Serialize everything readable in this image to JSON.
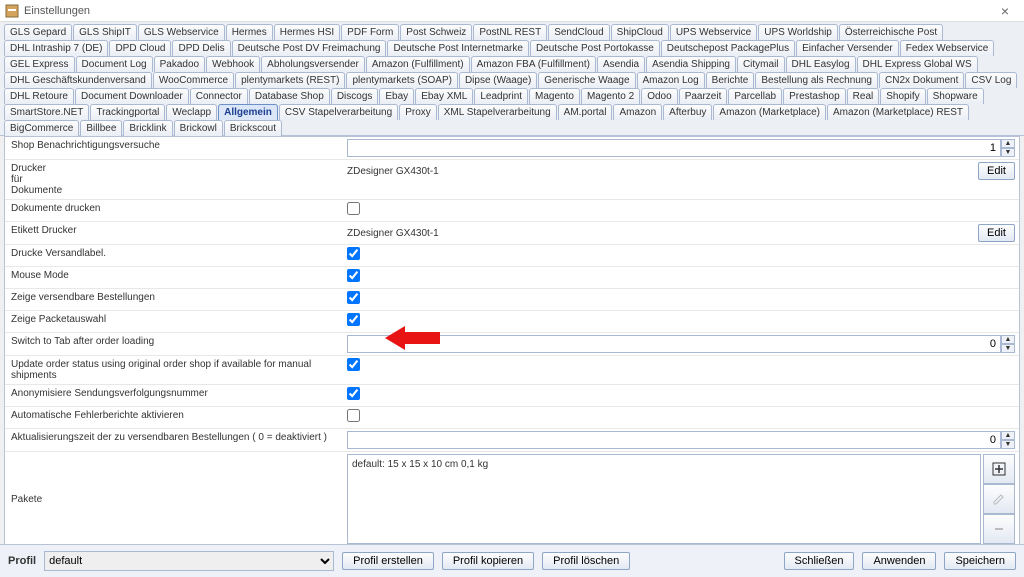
{
  "window": {
    "title": "Einstellungen"
  },
  "tabs_primary": [
    "GLS Gepard",
    "GLS ShipIT",
    "GLS Webservice",
    "Hermes",
    "Hermes HSI",
    "PDF Form",
    "Post Schweiz",
    "PostNL REST",
    "SendCloud",
    "ShipCloud",
    "UPS Webservice",
    "UPS Worldship",
    "Österreichische Post",
    "DHL Intraship 7 (DE)",
    "DPD Cloud",
    "DPD Delis",
    "Deutsche Post DV Freimachung",
    "Deutsche Post Internetmarke",
    "Deutsche Post Portokasse",
    "Deutschepost PackagePlus",
    "Einfacher Versender",
    "Fedex Webservice",
    "GEL Express",
    "Document Log",
    "Pakadoo",
    "Webhook",
    "Abholungsversender",
    "Amazon (Fulfillment)",
    "Amazon FBA (Fulfillment)",
    "Asendia",
    "Asendia Shipping",
    "Citymail",
    "DHL Easylog",
    "DHL Express Global WS",
    "DHL Geschäftskundenversand",
    "WooCommerce",
    "plentymarkets (REST)",
    "plentymarkets (SOAP)",
    "Dipse (Waage)",
    "Generische Waage",
    "Amazon Log",
    "Berichte",
    "Bestellung als Rechnung",
    "CN2x Dokument",
    "CSV Log",
    "DHL Retoure",
    "Document Downloader",
    "Connector",
    "Database Shop",
    "Discogs",
    "Ebay",
    "Ebay XML",
    "Leadprint",
    "Magento",
    "Magento 2",
    "Odoo",
    "Paarzeit",
    "Parcellab",
    "Prestashop",
    "Real",
    "Shopify",
    "Shopware",
    "SmartStore.NET",
    "Trackingportal",
    "Weclapp",
    "Allgemein",
    "CSV Stapelverarbeitung",
    "Proxy",
    "XML Stapelverarbeitung",
    "AM.portal",
    "Amazon",
    "Afterbuy",
    "Amazon (Marketplace)",
    "Amazon (Marketplace) REST",
    "BigCommerce",
    "Billbee",
    "Bricklink",
    "Brickowl",
    "Brickscout"
  ],
  "tabs_active": "Allgemein",
  "form": {
    "shop_notif_label": "Shop Benachrichtigungsversuche",
    "shop_notif_value": "1",
    "printer_label": "Drucker\nfür\nDokumente",
    "printer_value": "ZDesigner GX430t-1",
    "edit_label": "Edit",
    "print_docs_label": "Dokumente drucken",
    "label_printer_label": "Etikett Drucker",
    "label_printer_value": "ZDesigner GX430t-1",
    "print_shipping_label": "Drucke Versandlabel.",
    "mouse_mode_label": "Mouse Mode",
    "show_shippable_label": "Zeige versendbare Bestellungen",
    "show_packet_label": "Zeige Packetauswahl",
    "switch_tab_label": "Switch to Tab after order loading",
    "switch_tab_value": "0",
    "update_order_label": "Update order status using original order shop if available for manual shipments",
    "anonymize_label": "Anonymisiere Sendungsverfolgungsnummer",
    "auto_error_label": "Automatische Fehlerberichte aktivieren",
    "refresh_time_label": "Aktualisierungszeit der zu versendbaren Bestellungen ( 0 = deaktiviert )",
    "refresh_time_value": "0",
    "packages_label": "Pakete",
    "packages_default": "default: 15 x 15 x 10 cm 0,1 kg"
  },
  "footer": {
    "profile_label": "Profil",
    "profile_value": "default",
    "create_btn": "Profil erstellen",
    "copy_btn": "Profil kopieren",
    "delete_btn": "Profil löschen",
    "close_btn": "Schließen",
    "apply_btn": "Anwenden",
    "save_btn": "Speichern"
  }
}
